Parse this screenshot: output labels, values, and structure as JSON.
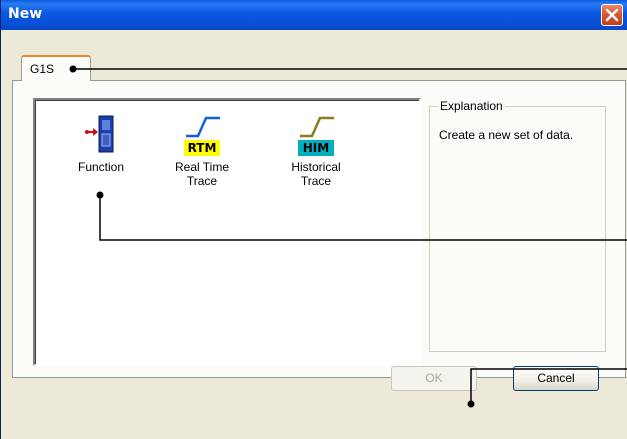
{
  "window": {
    "title": "New"
  },
  "tabs": [
    {
      "label": "G1S"
    }
  ],
  "items": [
    {
      "label_line1": "Function",
      "label_line2": ""
    },
    {
      "label_line1": "Real Time",
      "label_line2": "Trace",
      "badge": "RTM"
    },
    {
      "label_line1": "Historical",
      "label_line2": "Trace",
      "badge": "HIM"
    }
  ],
  "explanation": {
    "caption": "Explanation",
    "text": "Create a new set of data."
  },
  "buttons": {
    "ok": "OK",
    "cancel": "Cancel"
  },
  "colors": {
    "titlebar": "#0a58e0",
    "close": "#d7542e",
    "rtm_badge": "#ffff00",
    "him_badge": "#00b0c0",
    "trace_line_rtm": "#1060e0",
    "trace_line_him": "#8a7a20"
  }
}
